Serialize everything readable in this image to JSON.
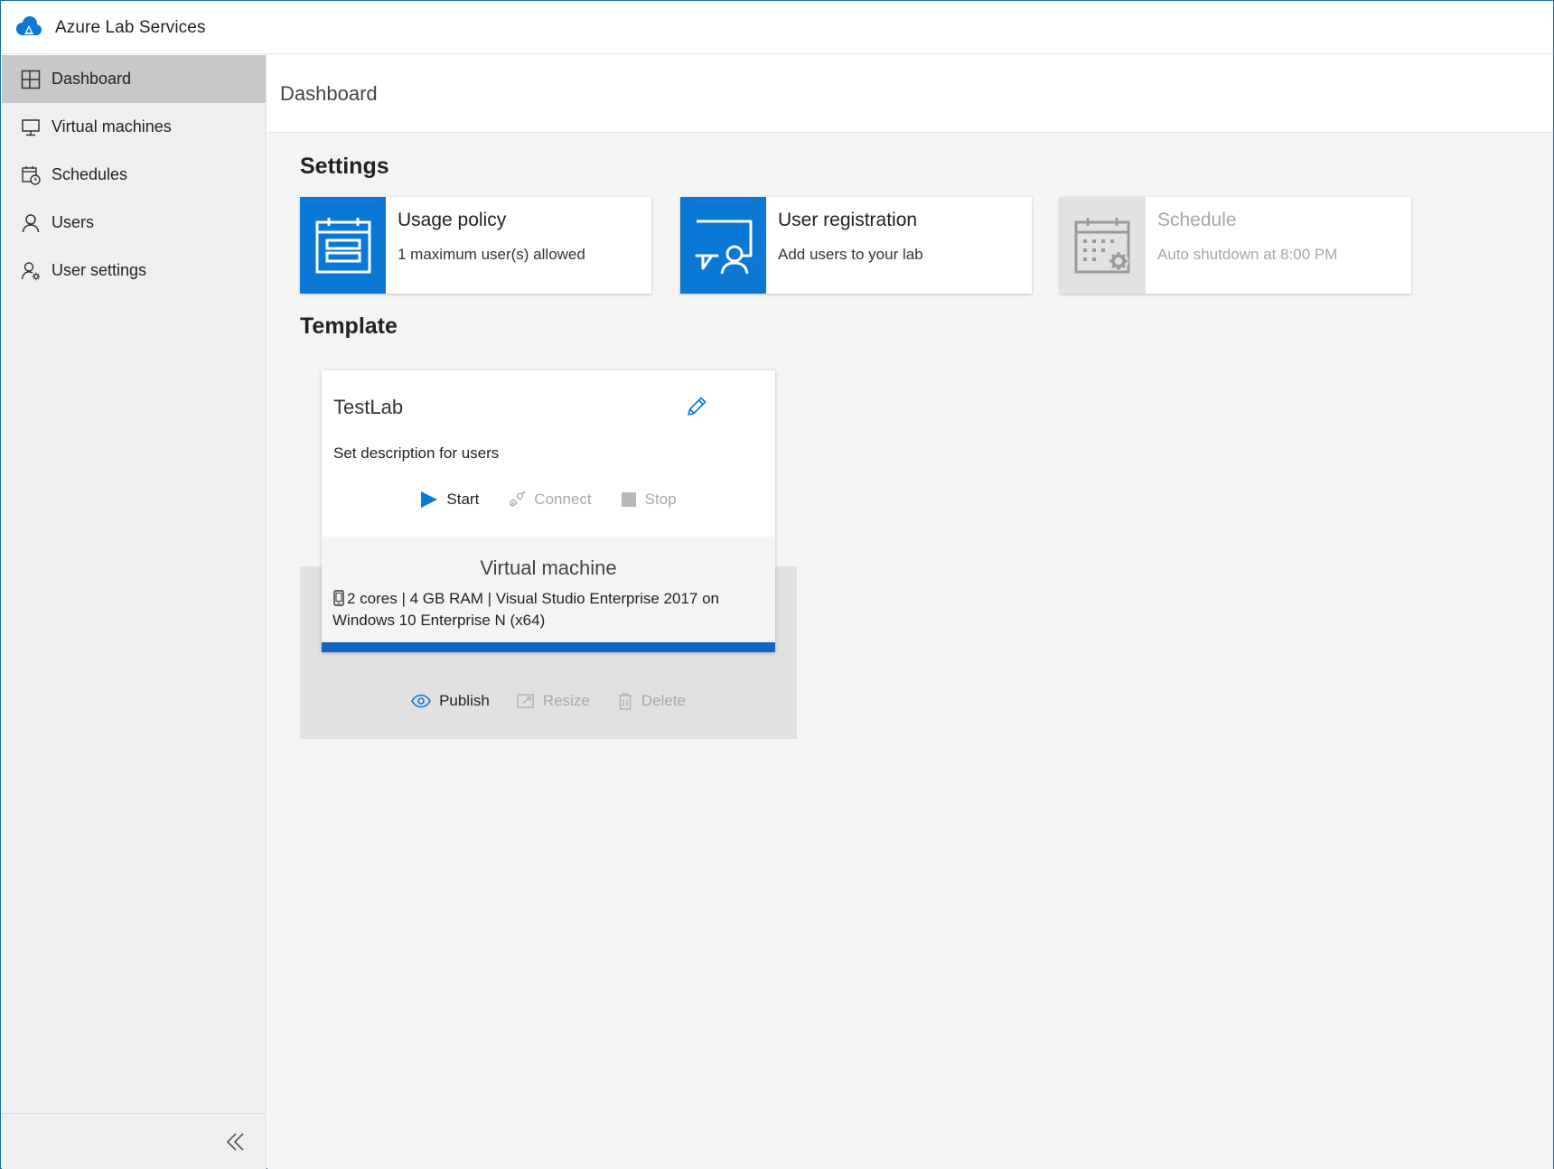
{
  "app": {
    "title": "Azure Lab Services",
    "logo_icon": "azure-lab-cloud-icon",
    "brand_color": "#0a78d4"
  },
  "sidebar": {
    "items": [
      {
        "label": "Dashboard",
        "icon": "dashboard-icon",
        "active": true
      },
      {
        "label": "Virtual machines",
        "icon": "monitor-icon",
        "active": false
      },
      {
        "label": "Schedules",
        "icon": "calendar-clock-icon",
        "active": false
      },
      {
        "label": "Users",
        "icon": "user-icon",
        "active": false
      },
      {
        "label": "User settings",
        "icon": "user-settings-icon",
        "active": false
      }
    ],
    "collapse_icon": "double-chevron-left-icon"
  },
  "page": {
    "title": "Dashboard"
  },
  "settings": {
    "title": "Settings",
    "cards": [
      {
        "title": "Usage policy",
        "subtitle": "1 maximum user(s) allowed",
        "icon": "usage-policy-icon",
        "enabled": true
      },
      {
        "title": "User registration",
        "subtitle": "Add users to your lab",
        "icon": "user-registration-icon",
        "enabled": true
      },
      {
        "title": "Schedule",
        "subtitle": "Auto shutdown at 8:00 PM",
        "icon": "schedule-icon",
        "enabled": false
      }
    ]
  },
  "template": {
    "title": "Template",
    "name": "TestLab",
    "description": "Set description for users",
    "actions": [
      {
        "label": "Start",
        "icon": "play-icon",
        "enabled": true
      },
      {
        "label": "Connect",
        "icon": "plug-icon",
        "enabled": false
      },
      {
        "label": "Stop",
        "icon": "stop-icon",
        "enabled": false
      }
    ],
    "vm": {
      "title": "Virtual machine",
      "spec": "2 cores | 4 GB RAM | Visual Studio Enterprise 2017 on Windows 10 Enterprise N (x64)"
    },
    "bottom_actions": [
      {
        "label": "Publish",
        "icon": "eye-icon",
        "enabled": true
      },
      {
        "label": "Resize",
        "icon": "resize-icon",
        "enabled": false
      },
      {
        "label": "Delete",
        "icon": "trash-icon",
        "enabled": false
      }
    ]
  }
}
